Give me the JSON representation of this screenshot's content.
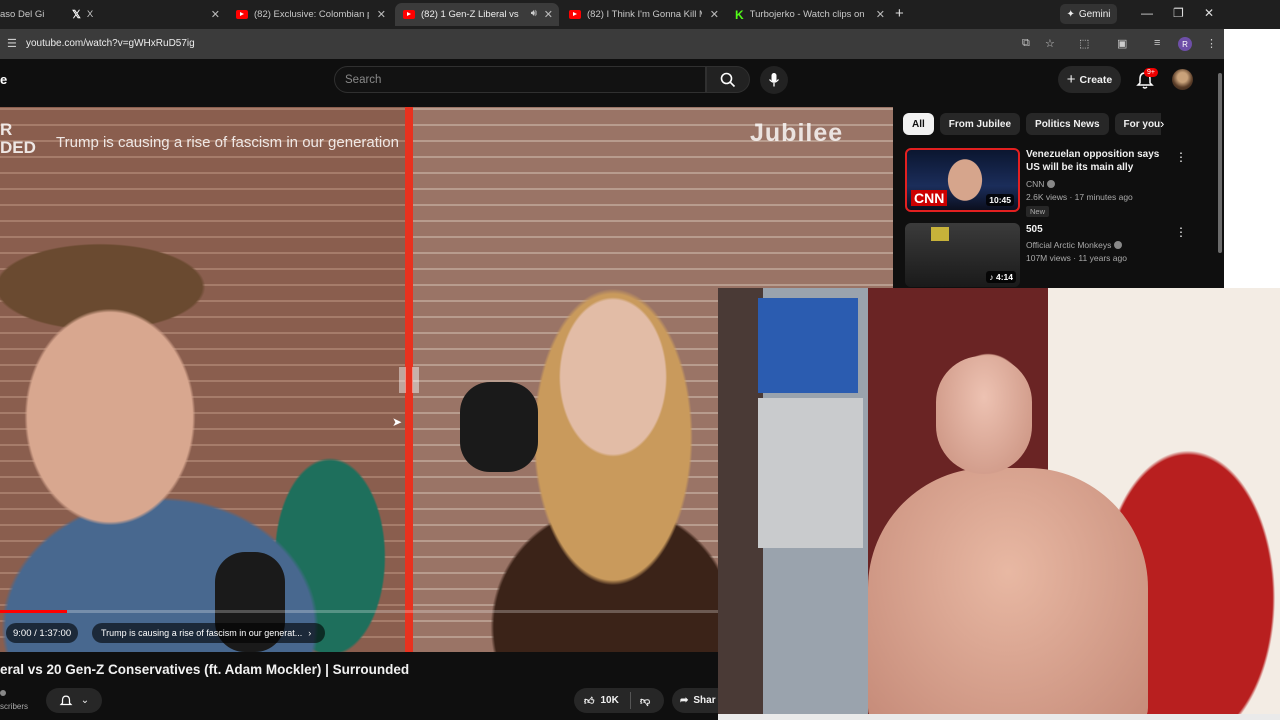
{
  "browser": {
    "tabs": [
      {
        "title": "aso Del Gi",
        "icon": "none"
      },
      {
        "title": "X",
        "icon": "x-logo-icon"
      },
      {
        "title": "(82) Exclusive: Colombian presi",
        "icon": "youtube-icon"
      },
      {
        "title": "(82) 1 Gen-Z Liberal vs 20 G",
        "icon": "youtube-icon",
        "active": true
      },
      {
        "title": "(82) I Think I'm Gonna Kill Mys",
        "icon": "youtube-icon"
      },
      {
        "title": "Turbojerko - Watch clips on Ki",
        "icon": "kick-icon"
      }
    ],
    "gemini_label": "Gemini",
    "url": "youtube.com/watch?v=gWHxRuD57ig",
    "profile_initial": "R"
  },
  "header": {
    "logo_fragment": "e",
    "search_placeholder": "Search",
    "create_label": "Create",
    "notification_count": "9+"
  },
  "player": {
    "overlay_title": "Trump is causing a rise of fascism in our generation",
    "left_logo_text": "R\nDED",
    "watermark": "Jubilee",
    "current_time": "9:00 / 1:37:00",
    "progress_fraction": 0.093,
    "chapter": "Trump is causing a rise of fascism in our generat..."
  },
  "video": {
    "title": "eral vs 20 Gen-Z Conservatives (ft. Adam Mockler) | Surrounded",
    "subscribers_fragment": "scribers",
    "likes": "10K",
    "share_label": "Shar"
  },
  "recommendations": {
    "chips": [
      "All",
      "From Jubilee",
      "Politics News",
      "For you"
    ],
    "items": [
      {
        "title": "Venezuelan opposition says US will be its main ally",
        "channel": "CNN",
        "meta": "2.6K views · 17 minutes ago",
        "badge": "New",
        "duration": "10:45",
        "thumb_text": "CNN"
      },
      {
        "title": "505",
        "channel": "Official Arctic Monkeys",
        "meta": "107M views · 11 years ago",
        "duration": "4:14"
      }
    ]
  },
  "colors": {
    "youtube_red": "#ff0000",
    "divider_red": "#e8321f",
    "kick_green": "#53fc18"
  }
}
